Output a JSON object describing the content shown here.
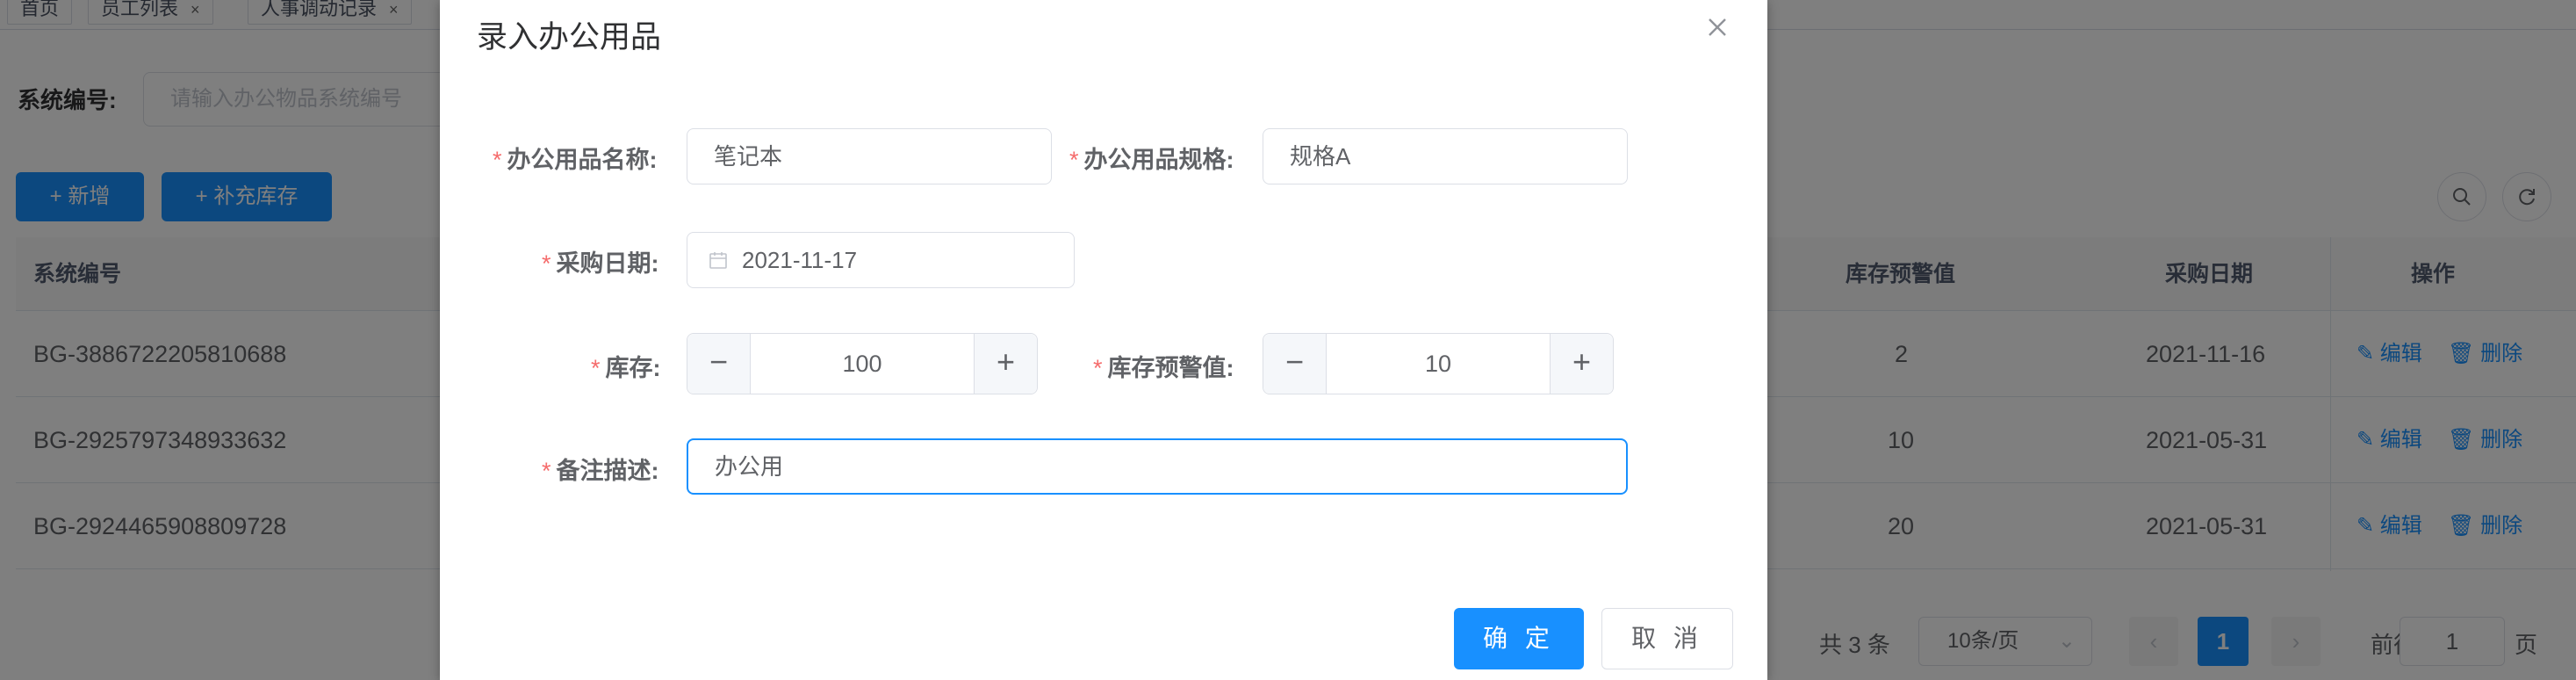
{
  "tabs": [
    {
      "label": "首页",
      "closable": false
    },
    {
      "label": "员工列表",
      "close_icon": "×"
    },
    {
      "label": "人事调动记录",
      "close_icon": "×"
    }
  ],
  "search": {
    "label": "系统编号:",
    "placeholder": "请输入办公物品系统编号"
  },
  "toolbar": {
    "add_label": "新增",
    "restock_label": "补充库存",
    "plus_icon": "+"
  },
  "table": {
    "headers": {
      "system_no": "系统编号",
      "stock_warning": "库存预警值",
      "purchase_date": "采购日期",
      "actions": "操作"
    },
    "rows": [
      {
        "system_no": "BG-3886722205810688",
        "stock_warning": "2",
        "purchase_date": "2021-11-16",
        "edit": "编辑",
        "delete": "删除"
      },
      {
        "system_no": "BG-2925797348933632",
        "stock_warning": "10",
        "purchase_date": "2021-05-31",
        "edit": "编辑",
        "delete": "删除"
      },
      {
        "system_no": "BG-2924465908809728",
        "stock_warning": "20",
        "purchase_date": "2021-05-31",
        "edit": "编辑",
        "delete": "删除"
      }
    ]
  },
  "pagination": {
    "total": "共 3 条",
    "page_size": "10条/页",
    "current": "1",
    "goto_prefix": "前往",
    "goto_value": "1",
    "goto_suffix": "页"
  },
  "dialog": {
    "title": "录入办公用品",
    "fields": {
      "name": {
        "label": "办公用品名称:",
        "value": "笔记本"
      },
      "spec": {
        "label": "办公用品规格:",
        "value": "规格A"
      },
      "date": {
        "label": "采购日期:",
        "value": "2021-11-17"
      },
      "stock": {
        "label": "库存:",
        "value": "100"
      },
      "warning": {
        "label": "库存预警值:",
        "value": "10"
      },
      "remark": {
        "label": "备注描述:",
        "value": "办公用"
      }
    },
    "required_mark": "*",
    "minus": "−",
    "plus": "+",
    "confirm_label": "确 定",
    "cancel_label": "取 消"
  },
  "colors": {
    "primary": "#1890ff",
    "required": "#f56c6c",
    "mask": "rgba(0,0,0,0.5)"
  },
  "icons": [
    "close-icon",
    "calendar-icon",
    "search-icon",
    "refresh-icon",
    "edit-icon",
    "delete-icon",
    "chevron-down-icon",
    "chevron-left-icon",
    "chevron-right-icon"
  ]
}
